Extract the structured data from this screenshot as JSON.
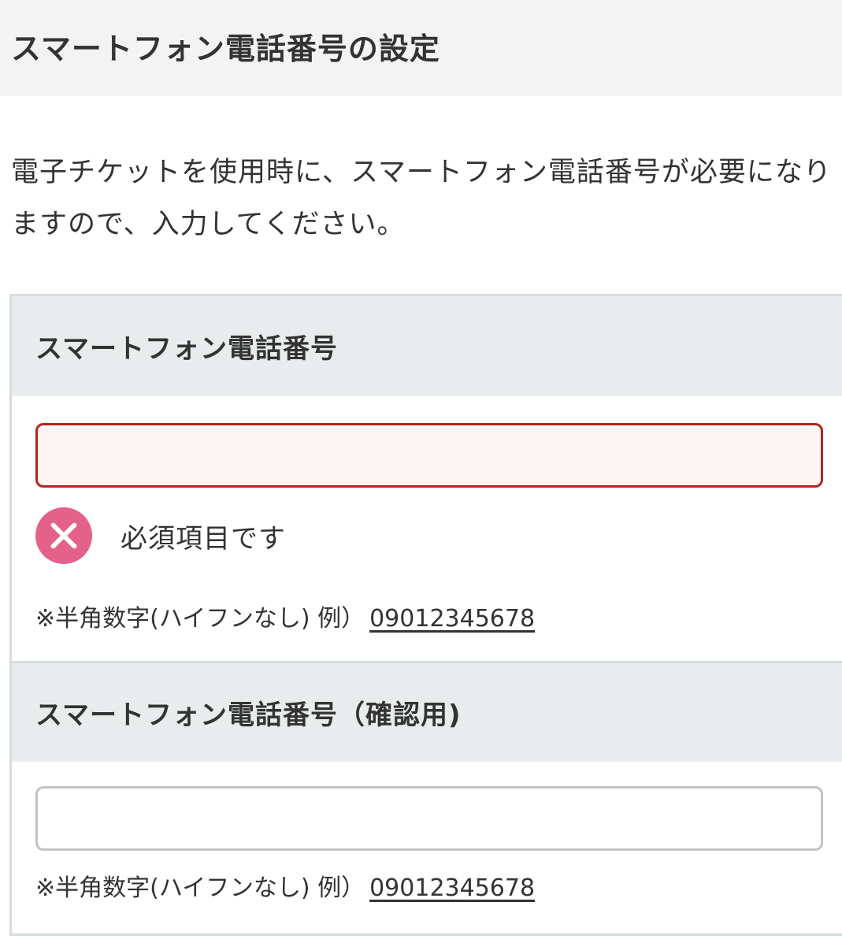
{
  "header": {
    "title": "スマートフォン電話番号の設定"
  },
  "description": "電子チケットを使用時に、スマートフォン電話番号が必要になりますので、入力してください。",
  "form": {
    "phone": {
      "label": "スマートフォン電話番号",
      "value": "",
      "placeholder": "",
      "error_message": "必須項目です",
      "error_icon": "error-x-icon",
      "hint_prefix": "※半角数字(ハイフンなし) 例）",
      "hint_example": "09012345678"
    },
    "phone_confirm": {
      "label": "スマートフォン電話番号（確認用)",
      "value": "",
      "placeholder": "",
      "hint_prefix": "※半角数字(ハイフンなし) 例）",
      "hint_example": "09012345678"
    }
  },
  "colors": {
    "error_border": "#b3261e",
    "error_background": "#faf5f3",
    "error_icon": "#e4628a",
    "section_header": "#e8ecec",
    "page_header": "#f3f3f3"
  }
}
